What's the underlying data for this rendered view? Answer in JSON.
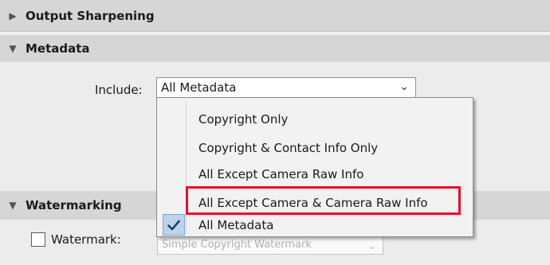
{
  "sections": {
    "output_sharpening": "Output Sharpening",
    "metadata": "Metadata",
    "watermarking": "Watermarking"
  },
  "metadata": {
    "include_label": "Include:",
    "include_value": "All Metadata",
    "dropdown_options": [
      "Copyright Only",
      "Copyright & Contact Info Only",
      "All Except Camera Raw Info",
      "All Except Camera & Camera Raw Info",
      "All Metadata"
    ],
    "selected_option": "All Metadata",
    "highlighted_option": "All Except Camera & Camera Raw Info"
  },
  "watermarking": {
    "checkbox_label": "Watermark:",
    "checked": false,
    "select_value": "Simple Copyright Watermark"
  },
  "colors": {
    "highlight_border": "#e8102a",
    "selected_tile": "#bcd3ea",
    "check": "#1f3f73"
  },
  "icons": {
    "collapsed": "triangle-right-icon",
    "expanded": "triangle-down-icon",
    "dropdown": "chevron-down-icon",
    "selected": "checkmark-icon"
  }
}
